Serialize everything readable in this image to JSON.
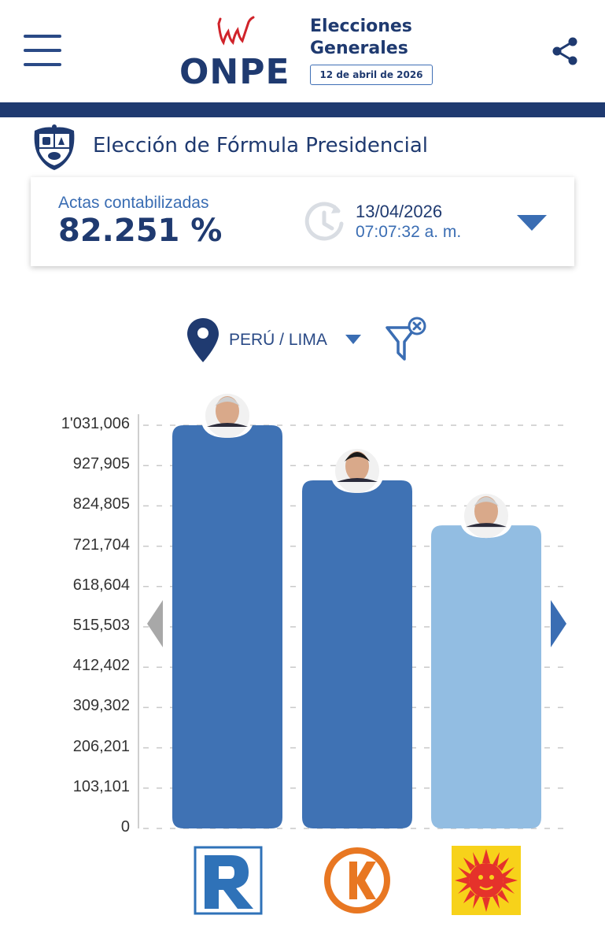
{
  "header": {
    "menu_icon": "hamburger-menu-icon",
    "logo_text": "ONPE",
    "event_title_line1": "Elecciones",
    "event_title_line2": "Generales",
    "event_date": "12 de abril de 2026",
    "share_icon": "share-icon"
  },
  "election": {
    "title": "Elección de Fórmula Presidencial",
    "emblem_icon": "peru-coat-of-arms-icon"
  },
  "summary": {
    "actas_label": "Actas contabilizadas",
    "actas_value": "82.251 %",
    "update_date": "13/04/2026",
    "update_time": "07:07:32 a. m.",
    "clock_icon": "history-clock-icon",
    "expand_icon": "caret-down-icon"
  },
  "location": {
    "label": "PERÚ / LIMA",
    "pin_icon": "location-pin-icon",
    "filter_clear_icon": "filter-clear-icon"
  },
  "colors": {
    "brand_navy": "#1f3a70",
    "bar_dark": "#3f72b4",
    "bar_light": "#92bde2",
    "accent_blue": "#3a6db3"
  },
  "chart_data": {
    "type": "bar",
    "ylim": [
      0,
      1031006
    ],
    "y_ticks": [
      "1'031,006",
      "927,905",
      "824,805",
      "721,704",
      "618,604",
      "515,503",
      "412,402",
      "309,302",
      "206,201",
      "103,101",
      "0"
    ],
    "y_tick_values": [
      1031006,
      927905,
      824805,
      721704,
      618604,
      515503,
      412402,
      309302,
      206201,
      103101,
      0
    ],
    "grid": true,
    "series": [
      {
        "values": [
          1031006,
          890000,
          775000
        ]
      }
    ],
    "bar_colors": [
      "#3f72b4",
      "#3f72b4",
      "#92bde2"
    ],
    "candidate_photos": [
      "candidate-photo-1",
      "candidate-photo-2",
      "candidate-photo-3"
    ],
    "party_logos": [
      "renovacion-popular-logo",
      "fuerza-popular-logo",
      "partido-sun-logo"
    ]
  },
  "navigation": {
    "prev_icon": "chevron-left-icon",
    "next_icon": "chevron-right-icon"
  }
}
